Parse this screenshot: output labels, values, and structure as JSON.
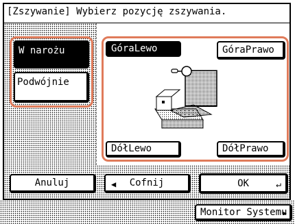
{
  "title": "[Zszywanie] Wybierz pozycję zszywania.",
  "mode_buttons": {
    "corner": "W narożu",
    "double": "Podwójnie"
  },
  "position_buttons": {
    "top_left": "GóraLewo",
    "top_right": "GóraPrawo",
    "bottom_left": "DółLewo",
    "bottom_right": "DółPrawo"
  },
  "footer": {
    "cancel": "Anuluj",
    "back": "Cofnij",
    "ok": "OK"
  },
  "system_monitor": "Monitor Systemu",
  "icons": {
    "back": "left-triangle-icon",
    "enter": "enter-icon",
    "monitor": "right-triangle-icon",
    "illustration": "stapling-position-illustration"
  },
  "colors": {
    "highlight": "#e07b5a",
    "selected": "#000000"
  },
  "selected": {
    "mode": "corner",
    "position": "top_left"
  }
}
